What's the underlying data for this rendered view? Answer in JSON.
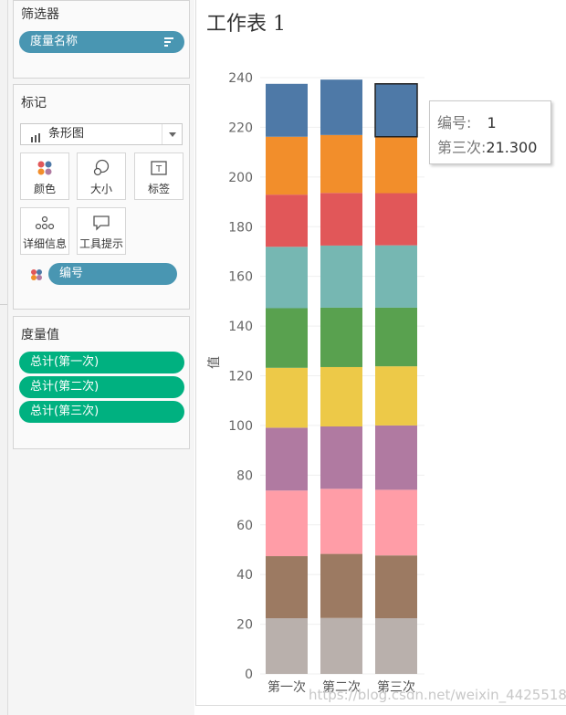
{
  "filters": {
    "title": "筛选器",
    "pill": "度量名称"
  },
  "marks": {
    "title": "标记",
    "mark_type": "条形图",
    "buttons": {
      "color": "颜色",
      "size": "大小",
      "label": "标签",
      "detail": "详细信息",
      "tooltip": "工具提示"
    },
    "pill": "编号"
  },
  "measure_values": {
    "title": "度量值",
    "pills": [
      "总计(第一次)",
      "总计(第二次)",
      "总计(第三次)"
    ]
  },
  "sheet": {
    "title": "工作表 1"
  },
  "tooltip": {
    "key1": "编号:",
    "val1": "1",
    "key2": "第三次:",
    "val2": "21.300"
  },
  "watermark": "https://blog.csdn.net/weixin_44255182",
  "chart_data": {
    "type": "bar",
    "stacked": true,
    "ylabel": "值",
    "xlabel": "",
    "ylim": [
      0,
      240
    ],
    "yticks": [
      0,
      20,
      40,
      60,
      80,
      100,
      120,
      140,
      160,
      180,
      200,
      220,
      240
    ],
    "categories": [
      "第一次",
      "第二次",
      "第三次"
    ],
    "series": [
      {
        "color": "#b9b0ac",
        "values": [
          22.4,
          22.5,
          22.4
        ]
      },
      {
        "color": "#9c7a62",
        "values": [
          25.0,
          25.8,
          25.3
        ]
      },
      {
        "color": "#ff9da7",
        "values": [
          26.4,
          26.2,
          26.4
        ]
      },
      {
        "color": "#b07aa1",
        "values": [
          25.3,
          25.1,
          25.9
        ]
      },
      {
        "color": "#edc948",
        "values": [
          24.1,
          23.9,
          23.8
        ]
      },
      {
        "color": "#59a14f",
        "values": [
          24.0,
          23.9,
          23.6
        ]
      },
      {
        "color": "#76b7b2",
        "values": [
          24.7,
          25.0,
          25.1
        ]
      },
      {
        "color": "#e15759",
        "values": [
          21.0,
          21.2,
          21.0
        ]
      },
      {
        "color": "#f28e2b",
        "values": [
          23.3,
          23.3,
          22.7
        ]
      },
      {
        "color": "#4e79a7",
        "values": [
          21.3,
          22.3,
          21.3
        ]
      }
    ],
    "highlight": {
      "category_index": 2,
      "series_index": 9
    }
  }
}
